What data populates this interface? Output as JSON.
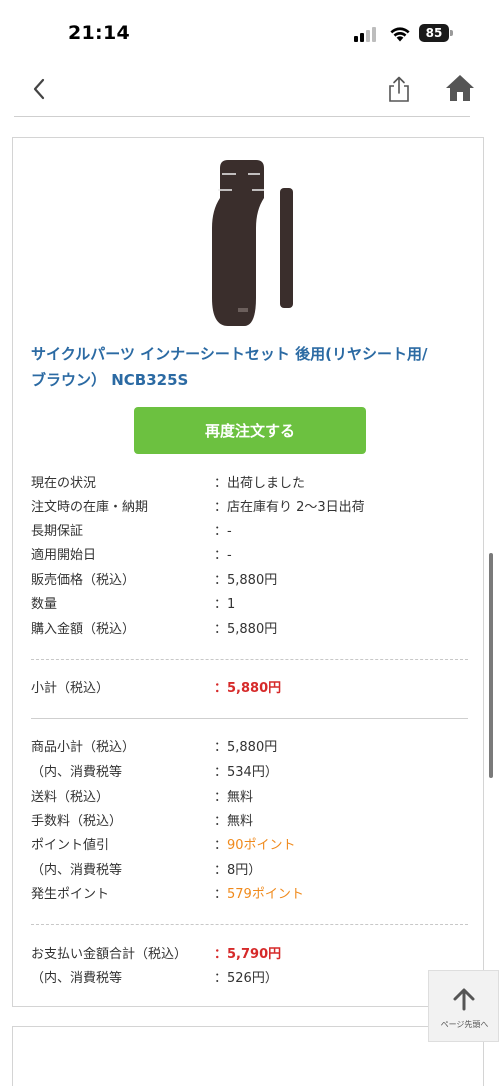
{
  "status_bar": {
    "time": "21:14",
    "battery": "85"
  },
  "nav": {
    "back_icon": "chevron-left-icon",
    "share_icon": "share-icon",
    "home_icon": "home-icon"
  },
  "product": {
    "title_line1": "サイクルパーツ インナーシートセット 後用(リヤシート用/",
    "title_line2": "ブラウン） NCB325S",
    "reorder_label": "再度注文する",
    "image_color": "#3a2e2c"
  },
  "details": [
    {
      "label": "現在の状況",
      "value": "：出荷しました"
    },
    {
      "label": "注文時の在庫・納期",
      "value": "：店在庫有り 2〜3日出荷"
    },
    {
      "label": "長期保証",
      "value": "：-"
    },
    {
      "label": "適用開始日",
      "value": "：-"
    },
    {
      "label": "販売価格（税込）",
      "value": "：5,880円"
    },
    {
      "label": "数量",
      "value": "：1"
    },
    {
      "label": "購入金額（税込）",
      "value": "：5,880円"
    }
  ],
  "subtotal": {
    "label": "小計（税込）",
    "value": "：5,880円"
  },
  "summary": [
    {
      "label": "商品小計（税込）",
      "value": "：5,880円"
    },
    {
      "label": "（内、消費税等",
      "value": "：534円）"
    },
    {
      "label": "送料（税込）",
      "value": "：無料"
    },
    {
      "label": "手数料（税込）",
      "value": "：無料"
    },
    {
      "label": "ポイント値引",
      "value_prefix": "：",
      "value": "90ポイント"
    },
    {
      "label": "（内、消費税等",
      "value": "：8円）"
    },
    {
      "label": "発生ポイント",
      "value_prefix": "：",
      "value": "579ポイント"
    }
  ],
  "total": {
    "label": "お支払い金額合計（税込）",
    "value": "：5,790円",
    "tax_label": "（内、消費税等",
    "tax_value": "：526円）"
  },
  "page_top": {
    "label": "ページ先頭へ"
  },
  "colors": {
    "accent_green": "#6cc140",
    "title_blue": "#2b6aa3",
    "price_red": "#d62a2a",
    "point_orange": "#f08a1c"
  }
}
